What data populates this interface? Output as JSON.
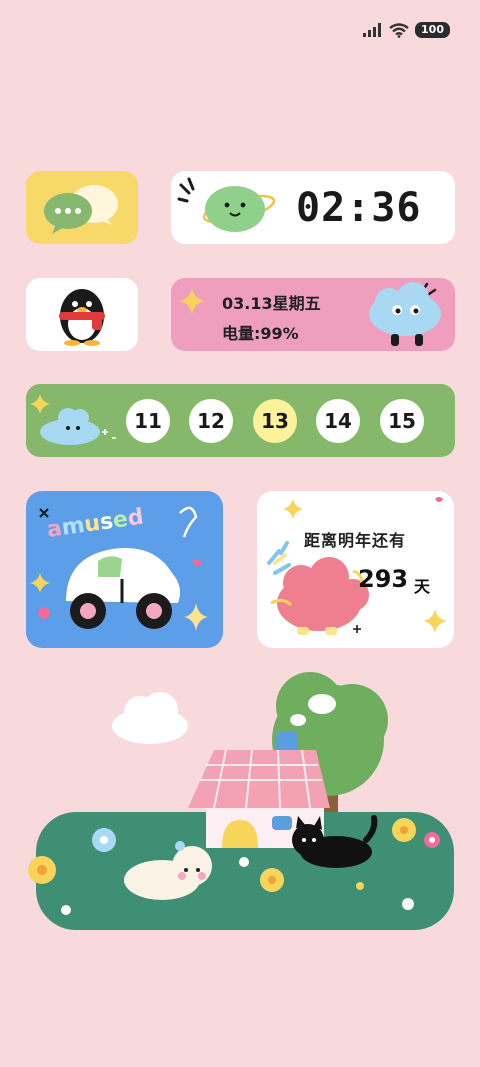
{
  "status_bar": {
    "battery": "100",
    "signal_icon": "signal-bars-icon",
    "wifi_icon": "wifi-icon"
  },
  "widgets": {
    "wechat": {
      "icon": "wechat-icon",
      "bg_color": "#f7d96a"
    },
    "clock": {
      "time": "02:36",
      "decoration": "planet-icon"
    },
    "qq": {
      "icon": "penguin-icon"
    },
    "info": {
      "date": "03.13星期五",
      "battery": "电量:99%",
      "bg_color": "#ef9fbd",
      "decoration": "cloud-character-icon"
    },
    "calendar_strip": {
      "bg_color": "#85b86a",
      "days": [
        "11",
        "12",
        "13",
        "14",
        "15"
      ],
      "active_index": 2
    },
    "amused": {
      "text": "amused",
      "bg_color": "#5c9ee8",
      "illustration": "car-illustration"
    },
    "countdown": {
      "label": "距离明年还有",
      "days": "293",
      "unit": "天"
    }
  },
  "colors": {
    "background": "#f8d9dc",
    "grass": "#3f8f74",
    "roof": "#f3a2b4",
    "tree": "#6fae5e"
  }
}
